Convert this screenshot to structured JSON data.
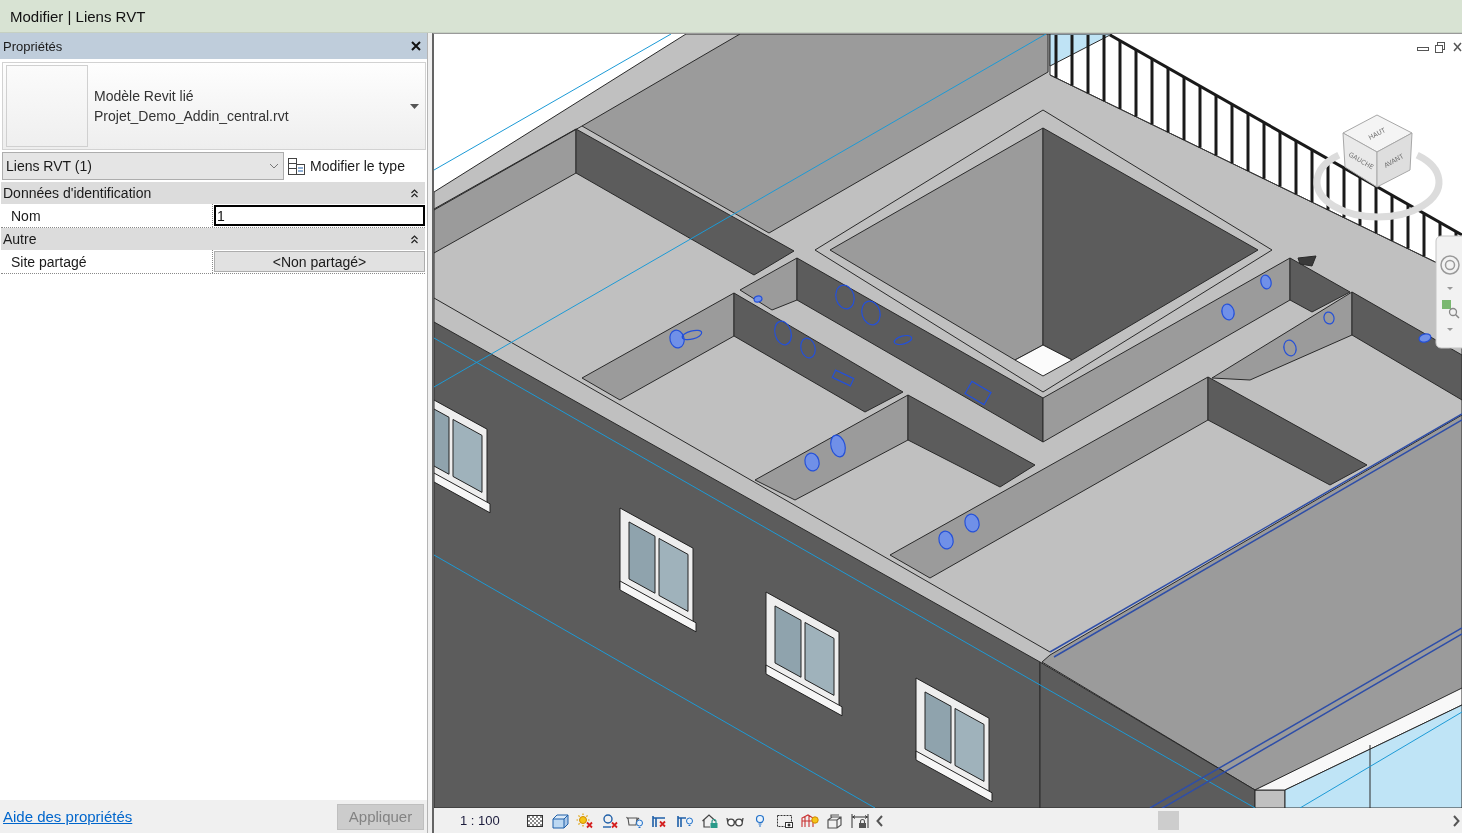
{
  "title_bar": {
    "title": "Modifier | Liens RVT"
  },
  "properties": {
    "title": "Propriétés",
    "type_selector": {
      "family": "Modèle Revit lié",
      "type": "Projet_Demo_Addin_central.rvt"
    },
    "instance_filter": "Liens RVT (1)",
    "edit_type_button": "Modifier le type",
    "groups": [
      {
        "title": "Données d'identification",
        "expanded": true,
        "rows": [
          {
            "label": "Nom",
            "kind": "text",
            "value": "1",
            "editing": true
          }
        ]
      },
      {
        "title": "Autre",
        "expanded": true,
        "rows": [
          {
            "label": "Site partagé",
            "kind": "button",
            "value": "<Non partagé>",
            "editing": false
          }
        ]
      }
    ],
    "help_link": "Aide des propriétés",
    "apply_button": {
      "label": "Appliquer",
      "disabled": true
    }
  },
  "view": {
    "view_cube": {
      "top": "HAUT",
      "left": "GAUCHE",
      "front": "AVANT"
    },
    "scale": "1 : 100"
  }
}
